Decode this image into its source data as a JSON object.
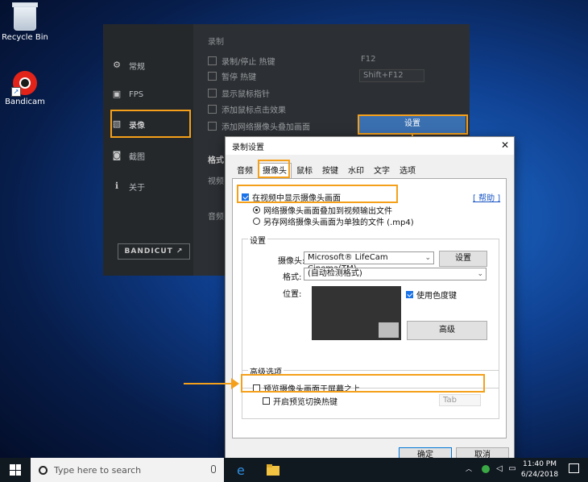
{
  "desktop": {
    "icons": [
      {
        "label": "Recycle Bin"
      },
      {
        "label": "Bandicam"
      }
    ]
  },
  "bandicam_window": {
    "sidebar": [
      {
        "label": "常规",
        "icon": "home-icon"
      },
      {
        "label": "FPS",
        "icon": "fps-icon"
      },
      {
        "label": "录像",
        "icon": "record-icon",
        "active": true
      },
      {
        "label": "截图",
        "icon": "camera-icon"
      },
      {
        "label": "关于",
        "icon": "info-icon"
      }
    ],
    "logo": "BANDICUT ↗",
    "section_title": "录制",
    "options": [
      {
        "label": "录制/停止 热键",
        "checked": true
      },
      {
        "label": "暂停 热键",
        "checked": false
      },
      {
        "label": "显示鼠标指针",
        "checked": false
      },
      {
        "label": "添加鼠标点击效果",
        "checked": false
      },
      {
        "label": "添加网络摄像头叠加画面",
        "checked": false
      }
    ],
    "hotkey_value": "F12",
    "pause_hotkey_value": "Shift+F12",
    "settings_button": "设置",
    "format_label": "格式",
    "video_label": "视频",
    "audio_label": "音频"
  },
  "dialog": {
    "title": "录制设置",
    "close": "✕",
    "tabs": [
      "音频",
      "摄像头",
      "鼠标",
      "按键",
      "水印",
      "文字",
      "选项"
    ],
    "selected_tab": "摄像头",
    "show_webcam_label": "在视频中显示摄像头画面",
    "help_link": "[ 帮助 ]",
    "radio_overlay": "网络摄像头画面叠加到视频输出文件",
    "radio_separate": "另存网络摄像头画面为单独的文件 (.mp4)",
    "settings_group": "设置",
    "camera_label": "摄像头:",
    "camera_value": "Microsoft® LifeCam Cinema(TM)",
    "camera_settings_button": "设置",
    "format_label": "格式:",
    "format_value": "(自动检测格式)",
    "position_label": "位置:",
    "chroma_key_label": "使用色度键",
    "advanced_button": "高级",
    "advanced_group": "高级选项",
    "preview_on_top_label": "预览摄像头画面于屏幕之上",
    "toggle_hotkey_label": "开启预览切换热键",
    "toggle_hotkey_value": "Tab",
    "ok_button": "确定",
    "cancel_button": "取消"
  },
  "taskbar": {
    "search_placeholder": "Type here to search",
    "time": "11:40 PM",
    "date": "6/24/2018"
  },
  "colors": {
    "annotation": "#f5a01a",
    "accent": "#1a73e8",
    "help_link": "#1a56c4"
  }
}
